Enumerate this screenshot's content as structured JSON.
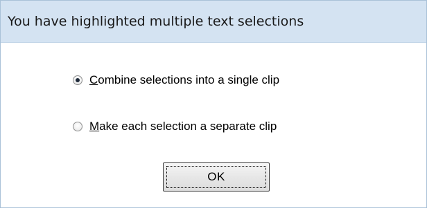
{
  "dialog": {
    "title": "You have highlighted multiple text selections",
    "options": [
      {
        "label_mnemonic": "C",
        "label_rest": "ombine selections into a single clip",
        "selected": true
      },
      {
        "label_mnemonic": "M",
        "label_rest": "ake each selection a separate clip",
        "selected": false
      }
    ],
    "ok_label": "OK"
  }
}
